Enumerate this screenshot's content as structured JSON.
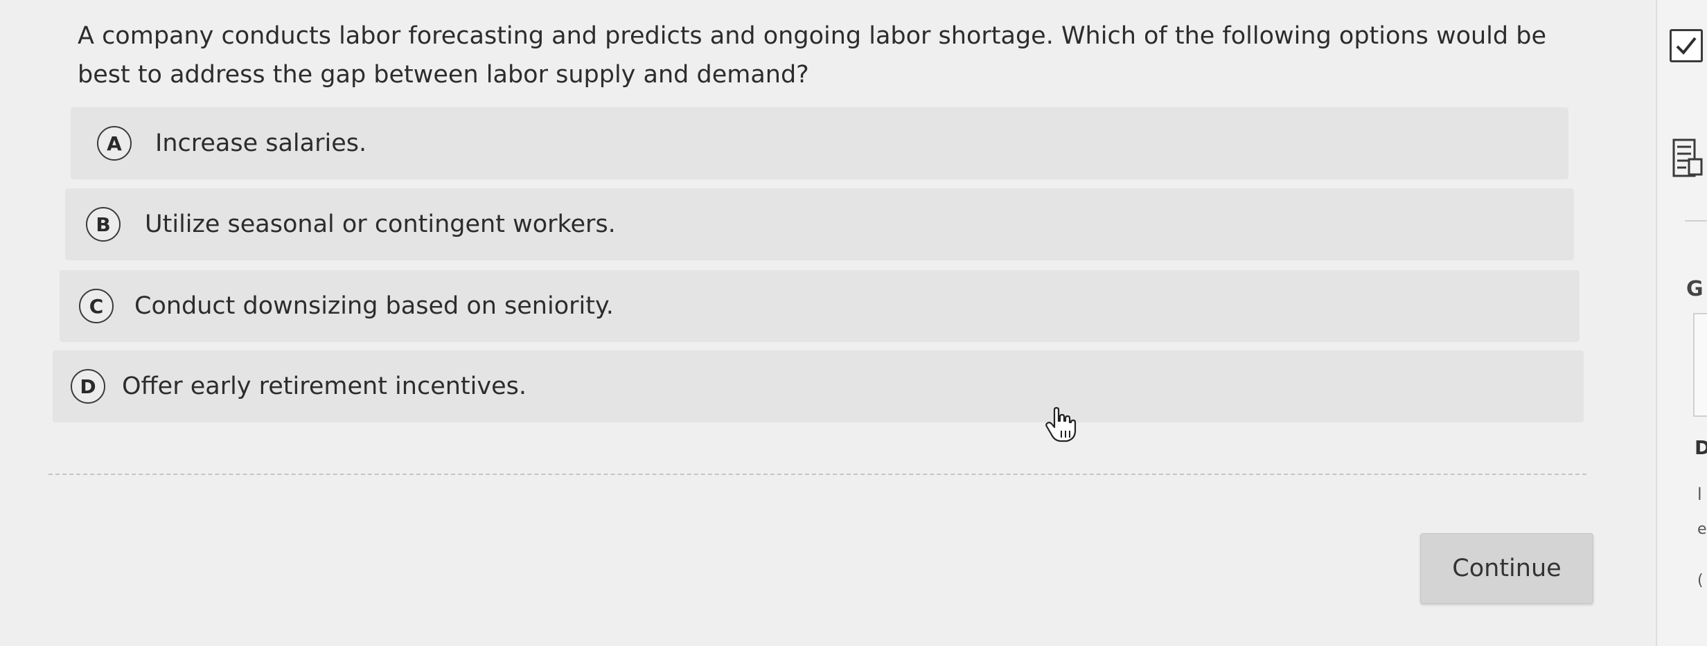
{
  "question": {
    "text": "A company conducts labor forecasting and predicts and ongoing labor shortage. Which of the following options would be best to address the gap between labor supply and demand?"
  },
  "options": [
    {
      "letter": "A",
      "text": "Increase salaries."
    },
    {
      "letter": "B",
      "text": "Utilize seasonal or contingent workers."
    },
    {
      "letter": "C",
      "text": "Conduct downsizing based on seniority."
    },
    {
      "letter": "D",
      "text": "Offer early retirement incentives."
    }
  ],
  "continue_label": "Continue",
  "right_panel": {
    "icons": [
      "checkbox-icon",
      "document-icon"
    ],
    "g_text": "G",
    "d_text": "D",
    "l_text": "l",
    "e_text": "e",
    "c_text": "("
  },
  "colors": {
    "background": "#efefef",
    "option_background": "#e4e4e4",
    "button_background": "#d4d4d4"
  }
}
